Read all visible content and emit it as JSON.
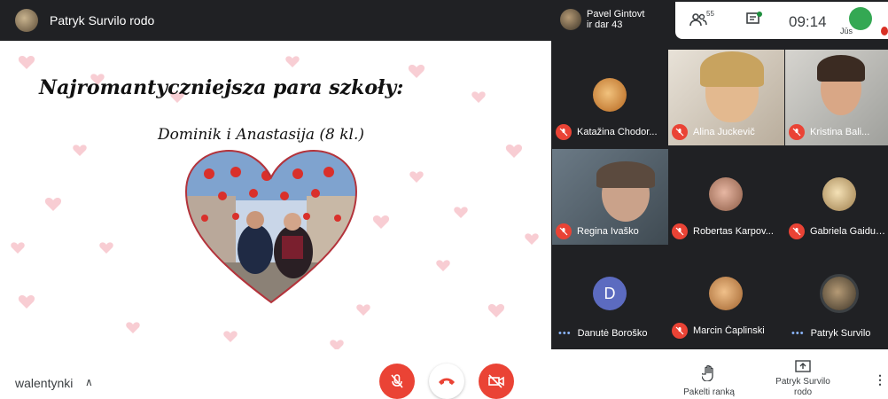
{
  "header": {
    "presenter": "Patryk Survilo rodo"
  },
  "slide": {
    "title": "Najromantyczniejsza para szkoły:",
    "subtitle": "Dominik i Anastasija (8 kl.)"
  },
  "panel": {
    "pinned_user_line1": "Pavel Gintovt",
    "pinned_user_line2": "ir dar 43",
    "people_count": "55",
    "time": "09:14",
    "self_label": "Jūs"
  },
  "participants": [
    {
      "name": "Katažina Chodor...",
      "muted": true
    },
    {
      "name": "Alina Juckevič",
      "muted": true
    },
    {
      "name": "Kristina Bali...",
      "muted": true
    },
    {
      "name": "Regina Ivaško",
      "muted": true
    },
    {
      "name": "Robertas Karpov...",
      "muted": true
    },
    {
      "name": "Gabriela Gaiduk...",
      "muted": true
    },
    {
      "name": "Danutė Boroško",
      "muted": false,
      "initial": "D"
    },
    {
      "name": "Marcin Čaplinski",
      "muted": true
    },
    {
      "name": "Patryk Survilo",
      "muted": false
    }
  ],
  "bottom": {
    "meeting_name": "walentynki",
    "raise_hand": "Pakelti ranką",
    "present_line1": "Patryk Survilo",
    "present_line2": "rodo"
  },
  "colors": {
    "danger": "#ea4335",
    "accent": "#1a73e8",
    "heart": "#f7c5cc"
  }
}
